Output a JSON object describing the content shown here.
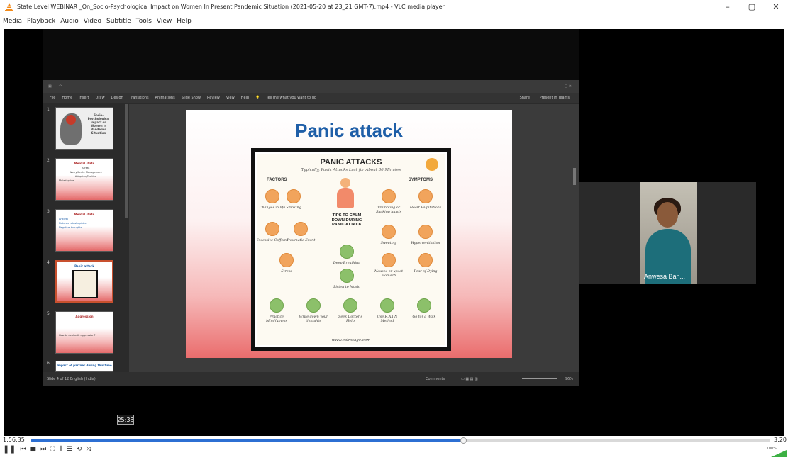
{
  "window": {
    "title": "State Level WEBINAR _On_Socio-Psychological Impact on Women In Present Pandemic Situation (2021-05-20 at 23_21 GMT-7).mp4 - VLC media player",
    "controls": {
      "minimize": "–",
      "maximize": "▢",
      "close": "✕"
    }
  },
  "menu": [
    "Media",
    "Playback",
    "Audio",
    "Video",
    "Subtitle",
    "Tools",
    "View",
    "Help"
  ],
  "ppt": {
    "ribbon_tabs": [
      "File",
      "Home",
      "Insert",
      "Draw",
      "Design",
      "Transitions",
      "Animations",
      "Slide Show",
      "Review",
      "View",
      "Help",
      "Tell me what you want to do"
    ],
    "right_buttons": [
      "Share",
      "Present in Teams"
    ],
    "status_left": "Slide 4 of 12    English (India)",
    "status_right": "Comments",
    "zoom_label": "96%",
    "thumbs": [
      {
        "num": "1",
        "title": "Socio-Psychological Impact on Women in Pandemic Situation",
        "lines": []
      },
      {
        "num": "2",
        "title": "Mental state",
        "lines": [
          "Stress",
          "Worry/Acute Management",
          "Adaptive/Positive",
          "Maladaptive"
        ]
      },
      {
        "num": "3",
        "title": "Mental state",
        "lines": [
          "Anxiety",
          "Pictures catastrophize",
          "Negative thoughts"
        ]
      },
      {
        "num": "4",
        "title": "Panic attack",
        "lines": []
      },
      {
        "num": "5",
        "title": "Aggression",
        "lines": [
          "How to deal with aggression?"
        ]
      },
      {
        "num": "6",
        "title": "Impact of partner during this time",
        "lines": []
      }
    ],
    "slide_title": "Panic attack",
    "poster": {
      "heading": "PANIC ATTACKS",
      "subheading": "Typically, Panic Attacks Last for About 30 Minutes",
      "factors_label": "FACTORS",
      "symptoms_label": "SYMPTOMS",
      "tips": "TIPS TO CALM DOWN DURING PANIC ATTACK",
      "factors": [
        "Changes in life",
        "Smoking",
        "Excessive Caffeine",
        "Traumatic Event",
        "Stress"
      ],
      "symptoms": [
        "Trembling or Shaking hands",
        "Heart Palpitations",
        "Sweating",
        "Hyperventilation",
        "Nausea or upset stomach",
        "Fear of Dying"
      ],
      "tips_items": [
        "Deep Breathing",
        "Listen to Music"
      ],
      "bottom_tips": [
        "Practice Mindfulness",
        "Write down your thoughts",
        "Seek Doctor's Help",
        "Use R.A.I.N Method",
        "Go for a Walk"
      ],
      "footer": "www.calmsage.com"
    }
  },
  "webcam": {
    "name": "Anwesa Ban..."
  },
  "tooltip_time": "25:38",
  "player": {
    "time_elapsed": "1:56:35",
    "time_total": "3:20",
    "progress": 0.584,
    "volume_label": "100%",
    "controls": [
      "❚❚",
      "⏮",
      "■",
      "⏭",
      "⛶",
      "⫼",
      "☰",
      "⟲",
      "⤨"
    ]
  }
}
